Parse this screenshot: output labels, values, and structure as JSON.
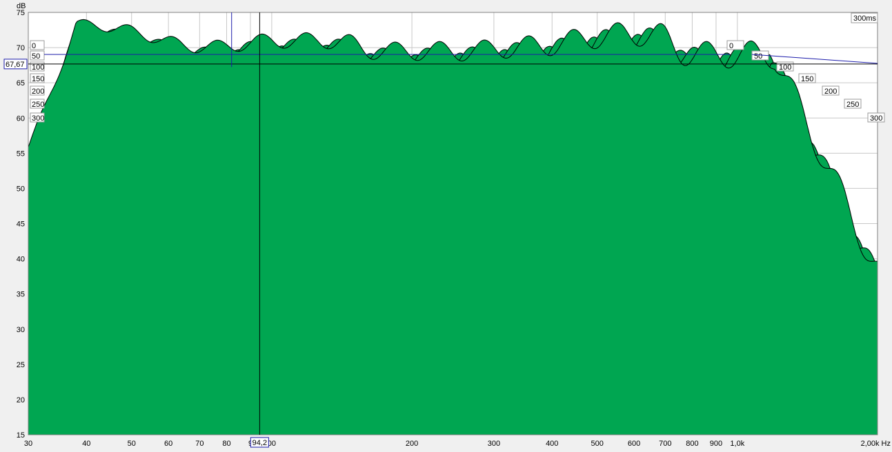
{
  "chart_data": {
    "type": "area",
    "ylabel": "dB",
    "xunit": "Hz",
    "ylim": [
      15,
      75
    ],
    "yticks": [
      "15",
      "20",
      "25",
      "30",
      "35",
      "40",
      "45",
      "50",
      "55",
      "60",
      "65",
      "70",
      "75"
    ],
    "xscale": "log",
    "xlim": [
      30,
      2000
    ],
    "xticks": [
      {
        "v": 30,
        "label": "30"
      },
      {
        "v": 40,
        "label": "40"
      },
      {
        "v": 50,
        "label": "50"
      },
      {
        "v": 60,
        "label": "60"
      },
      {
        "v": 70,
        "label": "70"
      },
      {
        "v": 80,
        "label": "80"
      },
      {
        "v": 90,
        "label": "9"
      },
      {
        "v": 100,
        "label": "00"
      },
      {
        "v": 200,
        "label": "200"
      },
      {
        "v": 300,
        "label": "300"
      },
      {
        "v": 400,
        "label": "400"
      },
      {
        "v": 500,
        "label": "500"
      },
      {
        "v": 600,
        "label": "600"
      },
      {
        "v": 700,
        "label": "700"
      },
      {
        "v": 800,
        "label": "800"
      },
      {
        "v": 900,
        "label": "900"
      },
      {
        "v": 1000,
        "label": "1,0k"
      },
      {
        "v": 2000,
        "label": "2,00k Hz"
      }
    ],
    "time_axis_label": "300ms",
    "time_ticks": [
      "0",
      "50",
      "100",
      "150",
      "200",
      "250",
      "300"
    ],
    "cursor": {
      "y": 67.67,
      "y_label": "67,67",
      "x": 94.2,
      "x_label": "94,2"
    },
    "crosshair_blue": {
      "x": 82,
      "y": 69.2
    },
    "fill_color": "#00a651",
    "line_color": "#000000",
    "slice_count": 45,
    "front_peaks": [
      {
        "f": 45,
        "db": 73.5
      },
      {
        "f": 49,
        "db": 73.3
      },
      {
        "f": 56,
        "db": 70
      },
      {
        "f": 70,
        "db": 70
      },
      {
        "f": 105,
        "db": 71
      },
      {
        "f": 220,
        "db": 69.5
      },
      {
        "f": 400,
        "db": 70
      },
      {
        "f": 500,
        "db": 72
      },
      {
        "f": 1050,
        "db": 69
      }
    ]
  }
}
